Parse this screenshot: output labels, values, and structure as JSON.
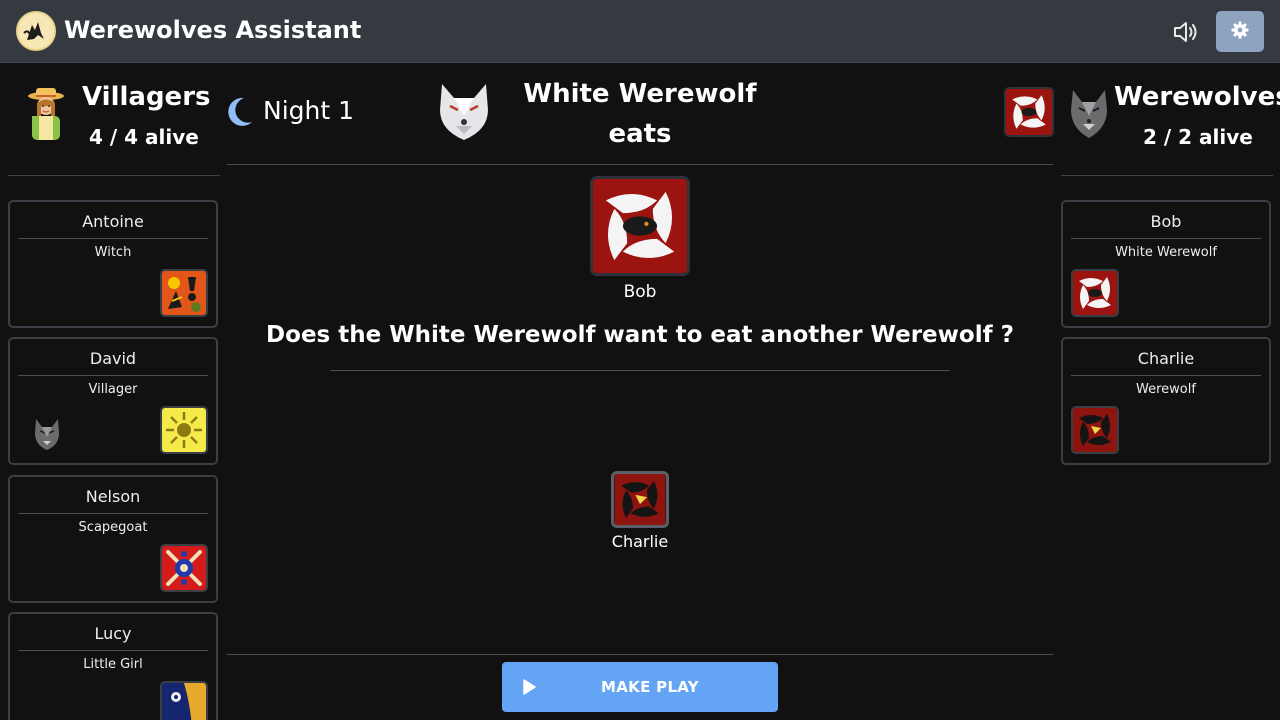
{
  "app": {
    "title": "Werewolves Assistant"
  },
  "toolbar": {
    "sound_icon": "speaker-icon",
    "settings_icon": "gear-icon"
  },
  "colors": {
    "accent": "#63a4f4",
    "topbar": "#343a40",
    "background": "#111111",
    "card_red": "#9b1410"
  },
  "villagers": {
    "name": "Villagers",
    "count": "4 / 4 alive",
    "players": [
      {
        "name": "Antoine",
        "role": "Witch"
      },
      {
        "name": "David",
        "role": "Villager"
      },
      {
        "name": "Nelson",
        "role": "Scapegoat"
      },
      {
        "name": "Lucy",
        "role": "Little Girl"
      }
    ]
  },
  "werewolves": {
    "name": "Werewolves",
    "count": "2 / 2 alive",
    "players": [
      {
        "name": "Bob",
        "role": "White Werewolf"
      },
      {
        "name": "Charlie",
        "role": "Werewolf"
      }
    ]
  },
  "game": {
    "night": "Night 1",
    "phase_title": "White Werewolf",
    "phase_action": "eats",
    "acting_player": "Bob",
    "question": "Does the White Werewolf want to eat another Werewolf ?",
    "choices": [
      {
        "name": "Charlie"
      }
    ],
    "make_play": "MAKE PLAY"
  }
}
